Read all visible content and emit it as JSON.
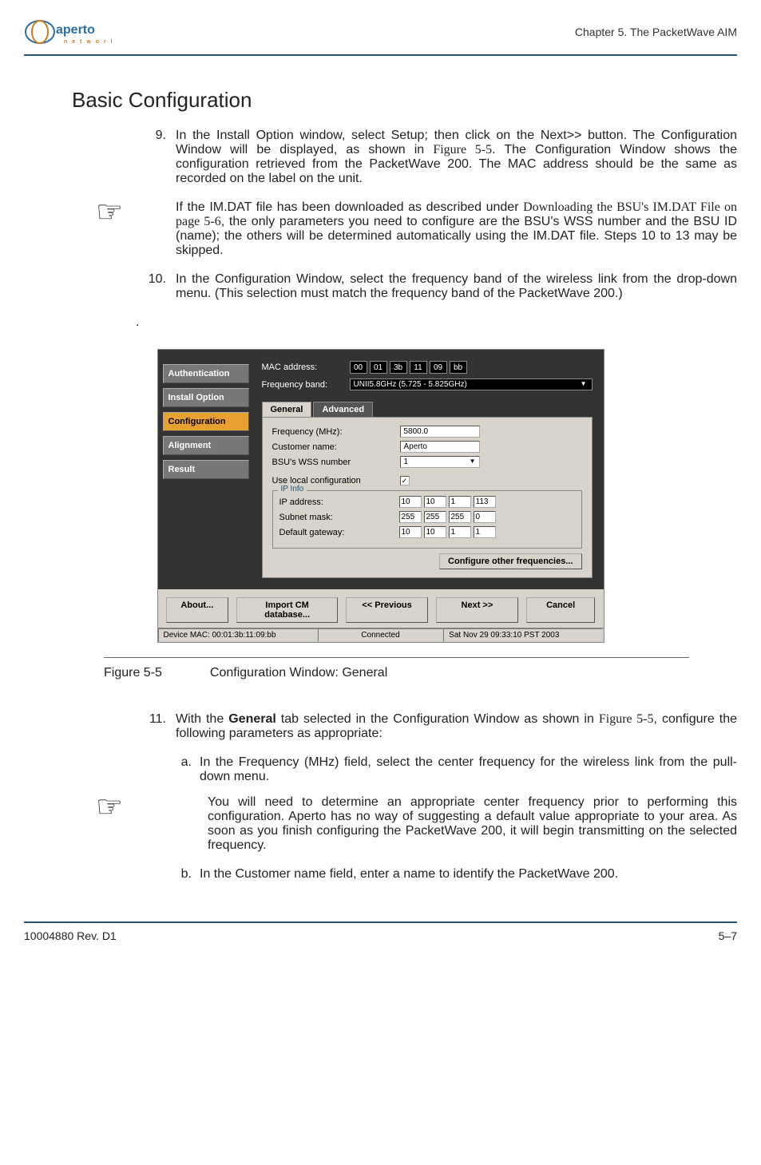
{
  "header": {
    "logo_alt": "aperto networks",
    "chapter": "Chapter 5.  The PacketWave AIM"
  },
  "section_title": "Basic Configuration",
  "step9": {
    "num": "9.",
    "text_a": "In the Install Option window, select Setup; then click on the Next>> button. The Configuration Window will be displayed, as shown in ",
    "fig_ref": "Figure 5-5",
    "text_b": ". The Configuration Window shows the configuration retrieved from the PacketWave 200. The MAC address should be the same as recorded on the label on the unit."
  },
  "note1": {
    "text_a": "If the IM.DAT file has been downloaded as described under ",
    "link": "Downloading the BSU's IM.DAT File",
    "page_ref": " on page 5-6",
    "text_b": ", the only parameters you need to configure are the BSU's WSS number and the BSU ID (name); the others will be determined automatically using the IM.DAT file. Steps 10 to 13 may be skipped."
  },
  "step10": {
    "num": "10.",
    "text": "In the Configuration Window, select the frequency band of the wireless link from the drop-down menu. (This selection must match the frequency band of the PacketWave 200.)"
  },
  "caption": {
    "fig_num": "Figure 5-5",
    "title": "Configuration Window: General"
  },
  "step11": {
    "num": "11.",
    "text_a": "With the ",
    "bold": "General",
    "text_b": " tab selected in the Configuration Window as shown in ",
    "fig_ref": "Figure 5-5",
    "text_c": ", configure the following parameters as appropriate:"
  },
  "step11a": {
    "letter": "a.",
    "text": "In the Frequency (MHz) field, select the center frequency for the wireless link from the pull-down menu."
  },
  "note2": {
    "text": "You will need to determine an appropriate center frequency prior to performing this configuration. Aperto has no way of suggesting a default value appropriate to your area. As soon as you finish configuring the PacketWave 200, it will begin transmitting on the selected frequency."
  },
  "step11b": {
    "letter": "b.",
    "text": "In the Customer name field, enter a name to identify the PacketWave 200."
  },
  "footer": {
    "left": "10004880 Rev. D1",
    "right": "5–7"
  },
  "window": {
    "nav": {
      "auth": "Authentication",
      "install": "Install Option",
      "config": "Configuration",
      "align": "Alignment",
      "result": "Result"
    },
    "mac_label": "MAC address:",
    "mac": [
      "00",
      "01",
      "3b",
      "11",
      "09",
      "bb"
    ],
    "freq_band_label": "Frequency band:",
    "freq_band": "UNII5.8GHz (5.725 - 5.825GHz)",
    "tabs": {
      "general": "General",
      "advanced": "Advanced"
    },
    "fields": {
      "freq_label": "Frequency (MHz):",
      "freq_value": "5800.0",
      "cust_label": "Customer name:",
      "cust_value": "Aperto",
      "wss_label": "BSU's WSS number",
      "wss_value": "1",
      "local_cfg_label": "Use local configuration",
      "local_cfg_checked": "✓"
    },
    "ip_info": {
      "legend": "IP Info",
      "ip_label": "IP address:",
      "ip": [
        "10",
        "10",
        "1",
        "113"
      ],
      "sn_label": "Subnet mask:",
      "sn": [
        "255",
        "255",
        "255",
        "0"
      ],
      "gw_label": "Default gateway:",
      "gw": [
        "10",
        "10",
        "1",
        "1"
      ]
    },
    "cfg_other_btn": "Configure other frequencies...",
    "buttons": {
      "about": "About...",
      "import": "Import CM database...",
      "prev": "<< Previous",
      "next": "Next >>",
      "cancel": "Cancel"
    },
    "status": {
      "mac": "Device MAC: 00:01:3b:11:09:bb",
      "conn": "Connected",
      "time": "Sat Nov 29 09:33:10 PST 2003"
    }
  }
}
